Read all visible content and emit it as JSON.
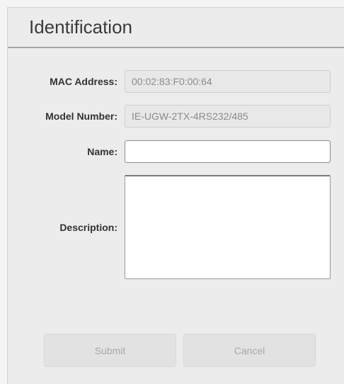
{
  "panel": {
    "title": "Identification"
  },
  "form": {
    "mac_address": {
      "label": "MAC Address:",
      "value": "00:02:83:F0:00:64"
    },
    "model_number": {
      "label": "Model Number:",
      "value": "IE-UGW-2TX-4RS232/485"
    },
    "name": {
      "label": "Name:",
      "value": ""
    },
    "description": {
      "label": "Description:",
      "value": ""
    }
  },
  "buttons": {
    "submit_label": "Submit",
    "cancel_label": "Cancel"
  },
  "colors": {
    "panel_background": "#ececec",
    "header_rule": "#a6a6a6",
    "readonly_background": "#e8e8e8",
    "button_background": "#e2e2e2",
    "disabled_text": "#a8a8a8"
  }
}
